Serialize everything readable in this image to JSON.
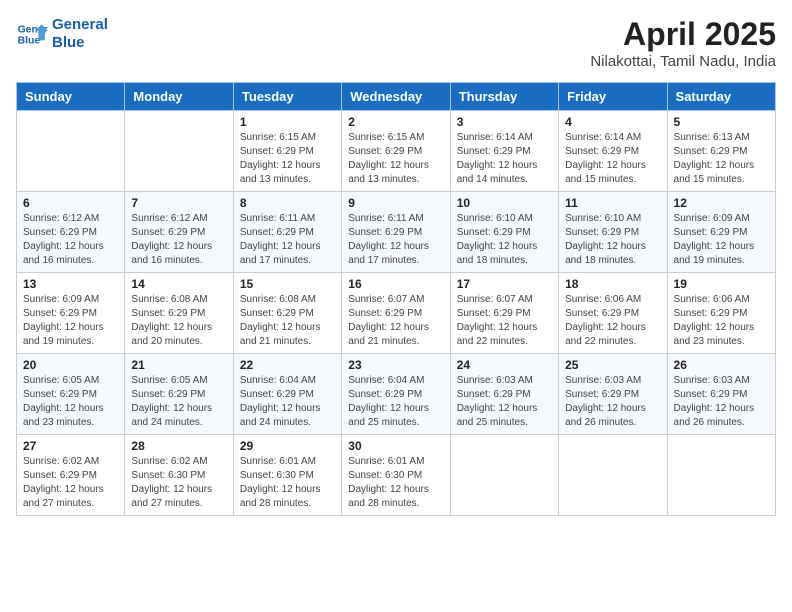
{
  "header": {
    "logo_line1": "General",
    "logo_line2": "Blue",
    "month": "April 2025",
    "location": "Nilakottai, Tamil Nadu, India"
  },
  "weekdays": [
    "Sunday",
    "Monday",
    "Tuesday",
    "Wednesday",
    "Thursday",
    "Friday",
    "Saturday"
  ],
  "weeks": [
    [
      {
        "day": "",
        "detail": ""
      },
      {
        "day": "",
        "detail": ""
      },
      {
        "day": "1",
        "detail": "Sunrise: 6:15 AM\nSunset: 6:29 PM\nDaylight: 12 hours and 13 minutes."
      },
      {
        "day": "2",
        "detail": "Sunrise: 6:15 AM\nSunset: 6:29 PM\nDaylight: 12 hours and 13 minutes."
      },
      {
        "day": "3",
        "detail": "Sunrise: 6:14 AM\nSunset: 6:29 PM\nDaylight: 12 hours and 14 minutes."
      },
      {
        "day": "4",
        "detail": "Sunrise: 6:14 AM\nSunset: 6:29 PM\nDaylight: 12 hours and 15 minutes."
      },
      {
        "day": "5",
        "detail": "Sunrise: 6:13 AM\nSunset: 6:29 PM\nDaylight: 12 hours and 15 minutes."
      }
    ],
    [
      {
        "day": "6",
        "detail": "Sunrise: 6:12 AM\nSunset: 6:29 PM\nDaylight: 12 hours and 16 minutes."
      },
      {
        "day": "7",
        "detail": "Sunrise: 6:12 AM\nSunset: 6:29 PM\nDaylight: 12 hours and 16 minutes."
      },
      {
        "day": "8",
        "detail": "Sunrise: 6:11 AM\nSunset: 6:29 PM\nDaylight: 12 hours and 17 minutes."
      },
      {
        "day": "9",
        "detail": "Sunrise: 6:11 AM\nSunset: 6:29 PM\nDaylight: 12 hours and 17 minutes."
      },
      {
        "day": "10",
        "detail": "Sunrise: 6:10 AM\nSunset: 6:29 PM\nDaylight: 12 hours and 18 minutes."
      },
      {
        "day": "11",
        "detail": "Sunrise: 6:10 AM\nSunset: 6:29 PM\nDaylight: 12 hours and 18 minutes."
      },
      {
        "day": "12",
        "detail": "Sunrise: 6:09 AM\nSunset: 6:29 PM\nDaylight: 12 hours and 19 minutes."
      }
    ],
    [
      {
        "day": "13",
        "detail": "Sunrise: 6:09 AM\nSunset: 6:29 PM\nDaylight: 12 hours and 19 minutes."
      },
      {
        "day": "14",
        "detail": "Sunrise: 6:08 AM\nSunset: 6:29 PM\nDaylight: 12 hours and 20 minutes."
      },
      {
        "day": "15",
        "detail": "Sunrise: 6:08 AM\nSunset: 6:29 PM\nDaylight: 12 hours and 21 minutes."
      },
      {
        "day": "16",
        "detail": "Sunrise: 6:07 AM\nSunset: 6:29 PM\nDaylight: 12 hours and 21 minutes."
      },
      {
        "day": "17",
        "detail": "Sunrise: 6:07 AM\nSunset: 6:29 PM\nDaylight: 12 hours and 22 minutes."
      },
      {
        "day": "18",
        "detail": "Sunrise: 6:06 AM\nSunset: 6:29 PM\nDaylight: 12 hours and 22 minutes."
      },
      {
        "day": "19",
        "detail": "Sunrise: 6:06 AM\nSunset: 6:29 PM\nDaylight: 12 hours and 23 minutes."
      }
    ],
    [
      {
        "day": "20",
        "detail": "Sunrise: 6:05 AM\nSunset: 6:29 PM\nDaylight: 12 hours and 23 minutes."
      },
      {
        "day": "21",
        "detail": "Sunrise: 6:05 AM\nSunset: 6:29 PM\nDaylight: 12 hours and 24 minutes."
      },
      {
        "day": "22",
        "detail": "Sunrise: 6:04 AM\nSunset: 6:29 PM\nDaylight: 12 hours and 24 minutes."
      },
      {
        "day": "23",
        "detail": "Sunrise: 6:04 AM\nSunset: 6:29 PM\nDaylight: 12 hours and 25 minutes."
      },
      {
        "day": "24",
        "detail": "Sunrise: 6:03 AM\nSunset: 6:29 PM\nDaylight: 12 hours and 25 minutes."
      },
      {
        "day": "25",
        "detail": "Sunrise: 6:03 AM\nSunset: 6:29 PM\nDaylight: 12 hours and 26 minutes."
      },
      {
        "day": "26",
        "detail": "Sunrise: 6:03 AM\nSunset: 6:29 PM\nDaylight: 12 hours and 26 minutes."
      }
    ],
    [
      {
        "day": "27",
        "detail": "Sunrise: 6:02 AM\nSunset: 6:29 PM\nDaylight: 12 hours and 27 minutes."
      },
      {
        "day": "28",
        "detail": "Sunrise: 6:02 AM\nSunset: 6:30 PM\nDaylight: 12 hours and 27 minutes."
      },
      {
        "day": "29",
        "detail": "Sunrise: 6:01 AM\nSunset: 6:30 PM\nDaylight: 12 hours and 28 minutes."
      },
      {
        "day": "30",
        "detail": "Sunrise: 6:01 AM\nSunset: 6:30 PM\nDaylight: 12 hours and 28 minutes."
      },
      {
        "day": "",
        "detail": ""
      },
      {
        "day": "",
        "detail": ""
      },
      {
        "day": "",
        "detail": ""
      }
    ]
  ]
}
